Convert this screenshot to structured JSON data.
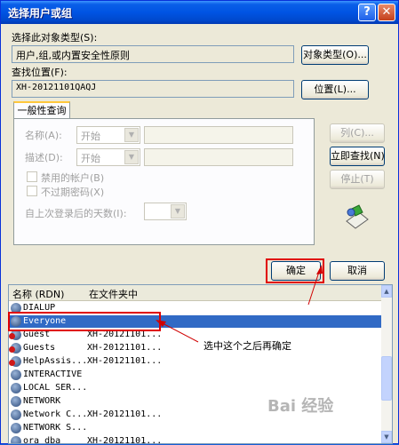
{
  "window": {
    "title": "选择用户或组"
  },
  "object_type": {
    "label": "选择此对象类型(S):",
    "value": "用户,组,或内置安全性原则",
    "button": "对象类型(O)..."
  },
  "location": {
    "label": "查找位置(F):",
    "value": "XH-20121101QAQJ",
    "button": "位置(L)..."
  },
  "tab": {
    "label": "一般性查询"
  },
  "query": {
    "name_label": "名称(A):",
    "name_mode": "开始",
    "desc_label": "描述(D):",
    "desc_mode": "开始",
    "disabled_accounts": "禁用的帐户(B)",
    "nonexpiring_pw": "不过期密码(X)",
    "days_since_login": "自上次登录后的天数(I):"
  },
  "side_buttons": {
    "columns": "列(C)...",
    "find_now": "立即查找(N)",
    "stop": "停止(T)"
  },
  "dialog_buttons": {
    "ok": "确定",
    "cancel": "取消"
  },
  "results": {
    "headers": {
      "name": "名称 (RDN)",
      "folder": "在文件夹中"
    },
    "rows": [
      {
        "name": "DIALUP",
        "folder": "",
        "icon": "group-icon"
      },
      {
        "name": "Everyone",
        "folder": "",
        "icon": "group-icon"
      },
      {
        "name": "Guest",
        "folder": "XH-20121101...",
        "icon": "user-disabled-icon"
      },
      {
        "name": "Guests",
        "folder": "XH-20121101...",
        "icon": "user-disabled-icon"
      },
      {
        "name": "HelpAssis...",
        "folder": "XH-20121101...",
        "icon": "user-disabled-icon"
      },
      {
        "name": "INTERACTIVE",
        "folder": "",
        "icon": "group-icon"
      },
      {
        "name": "LOCAL SER...",
        "folder": "",
        "icon": "group-icon"
      },
      {
        "name": "NETWORK",
        "folder": "",
        "icon": "group-icon"
      },
      {
        "name": "Network C...",
        "folder": "XH-20121101...",
        "icon": "group-icon"
      },
      {
        "name": "NETWORK S...",
        "folder": "",
        "icon": "group-icon"
      },
      {
        "name": "ora_dba",
        "folder": "XH-20121101...",
        "icon": "group-icon"
      }
    ]
  },
  "annotation": {
    "text": "选中这个之后再确定"
  },
  "watermark": {
    "text": "Bai 经验"
  },
  "colors": {
    "selection": "#316ac5",
    "highlight_box": "#e00000",
    "titlebar": "#0054e3"
  }
}
